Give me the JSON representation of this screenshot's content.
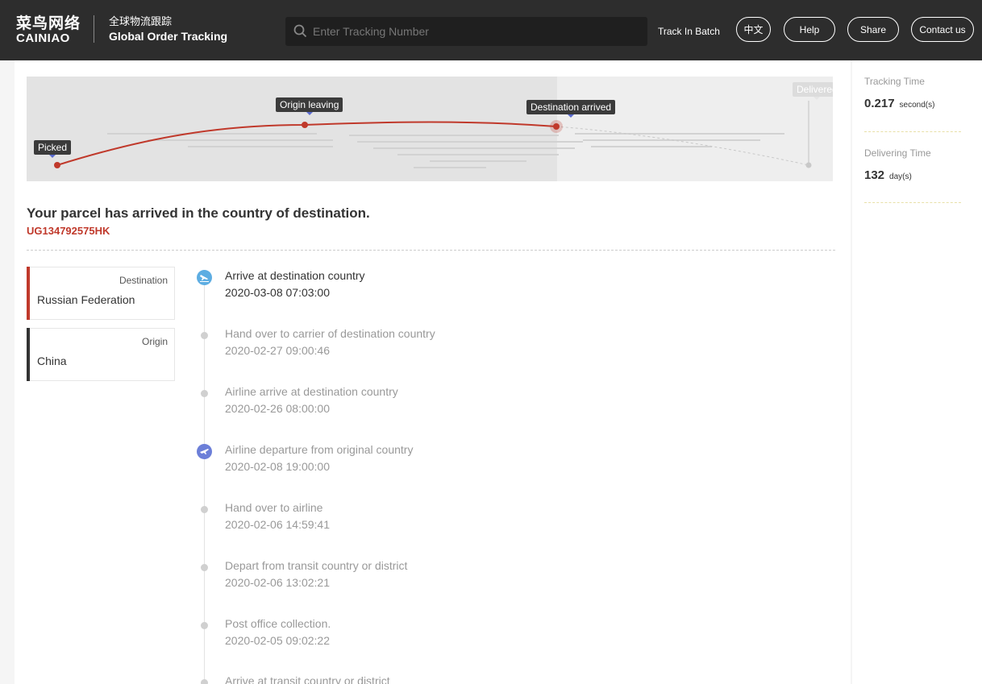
{
  "header": {
    "logo_cn": "菜鸟网络",
    "logo_en": "CAINIAO",
    "subtitle_cn": "全球物流跟踪",
    "subtitle_en": "Global Order Tracking",
    "search_placeholder": "Enter Tracking Number",
    "track_in_batch": "Track In Batch",
    "buttons": {
      "lang": "中文",
      "help": "Help",
      "share": "Share",
      "contact": "Contact us"
    }
  },
  "map": {
    "stages": [
      "Picked",
      "Origin leaving",
      "Destination arrived",
      "Delivered"
    ],
    "current_stage": "Destination arrived"
  },
  "parcel": {
    "status_title": "Your parcel has arrived in the country of destination.",
    "tracking_number": "UG134792575HK"
  },
  "route": {
    "destination_label": "Destination",
    "destination_value": "Russian Federation",
    "origin_label": "Origin",
    "origin_value": "China"
  },
  "events": [
    {
      "desc": "Arrive at destination country",
      "time": "2020-03-08 07:03:00",
      "icon": "plane-landing-icon"
    },
    {
      "desc": "Hand over to carrier of destination country",
      "time": "2020-02-27 09:00:46",
      "icon": "dot"
    },
    {
      "desc": "Airline arrive at destination country",
      "time": "2020-02-26 08:00:00",
      "icon": "dot"
    },
    {
      "desc": "Airline departure from original country",
      "time": "2020-02-08 19:00:00",
      "icon": "plane-takeoff-icon"
    },
    {
      "desc": "Hand over to airline",
      "time": "2020-02-06 14:59:41",
      "icon": "dot"
    },
    {
      "desc": "Depart from transit country or district",
      "time": "2020-02-06 13:02:21",
      "icon": "dot"
    },
    {
      "desc": "Post office collection.",
      "time": "2020-02-05 09:02:22",
      "icon": "dot"
    },
    {
      "desc": "Arrive at transit country or district",
      "time": "",
      "icon": "dot"
    }
  ],
  "stats": {
    "tracking_time_label": "Tracking Time",
    "tracking_time_value": "0.217",
    "tracking_time_unit": "second(s)",
    "delivering_time_label": "Delivering Time",
    "delivering_time_value": "132",
    "delivering_time_unit": "day(s)"
  },
  "colors": {
    "accent": "#c0392b",
    "header_bg": "#2d2d2d",
    "landing_icon": "#5dade2",
    "takeoff_icon": "#6c7fd8"
  }
}
